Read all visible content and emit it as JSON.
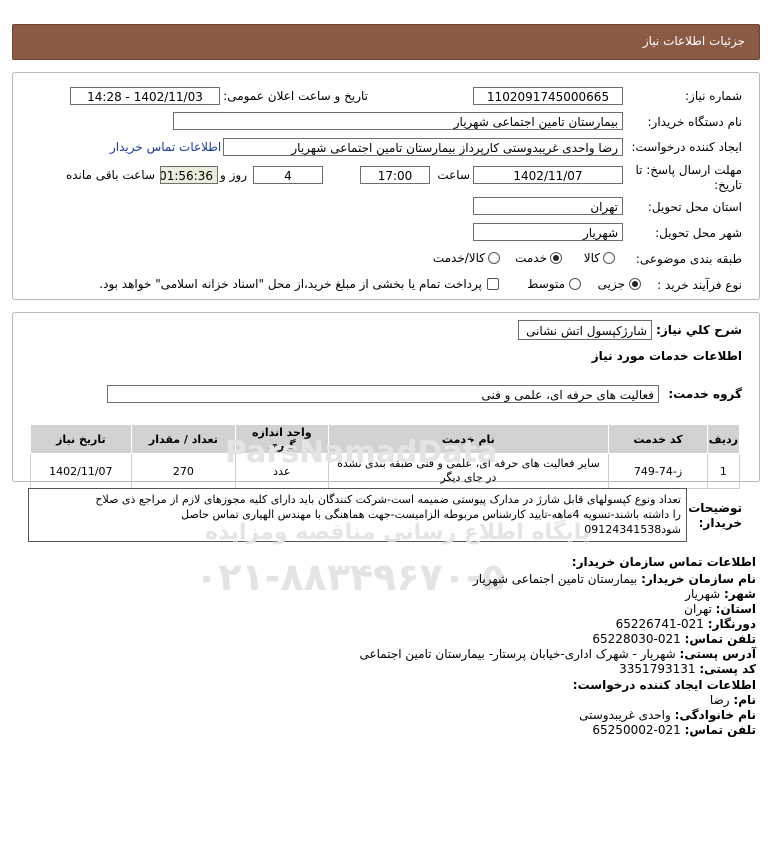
{
  "header": {
    "title": "جزئیات اطلاعات نیاز"
  },
  "need": {
    "number_label": "شماره نیاز:",
    "number": "1102091745000665",
    "announce_label": "تاریخ و ساعت اعلان عمومی:",
    "announce_value": "1402/11/03 - 14:28",
    "buyer_label": "نام دستگاه خریدار:",
    "buyer": "بیمارستان تامین اجتماعی شهریار",
    "creator_label": "ایجاد کننده درخواست:",
    "creator": "رضا واحدی غریبدوستی کارپرداز بیمارستان تامین اجتماعی شهریار",
    "contact_link": "اطلاعات تماس خریدار",
    "deadline_label_1": "مهلت ارسال پاسخ: تا",
    "deadline_label_2": "تاریخ:",
    "deadline_date": "1402/11/07",
    "time_label": "ساعت",
    "deadline_time": "17:00",
    "days": "4",
    "days_label": "روز و",
    "remaining": "01:56:36",
    "remaining_label": "ساعت باقی مانده",
    "province_label": "استان محل تحویل:",
    "province": "تهران",
    "city_label": "شهر محل تحویل:",
    "city": "شهریار",
    "category_label": "طبقه بندی موضوعی:",
    "category_options": [
      "کالا",
      "خدمت",
      "کالا/خدمت"
    ],
    "process_label": "نوع فرآیند خرید :",
    "process_options": [
      "جزیی",
      "متوسط"
    ],
    "payment_note": "پرداخت تمام یا بخشی از مبلغ خرید،از محل \"اسناد خزانه اسلامی\" خواهد بود."
  },
  "summary": {
    "label": "شرح کلي نياز:",
    "value": "شارژکپسول اتش نشانی",
    "section_title": "اطلاعات خدمات مورد نیاز",
    "group_label": "گروه خدمت:",
    "group_value": "فعالیت های حرفه ای، علمی و فنی"
  },
  "table": {
    "headers": [
      "ردیف",
      "کد خدمت",
      "نام خدمت",
      "واحد اندازه گیری",
      "تعداد / مقدار",
      "تاریخ نیاز"
    ],
    "rows": [
      {
        "row": "1",
        "code": "ز-74-749",
        "name_1": "سایر فعالیت های حرفه ای، علمی و فنی طبقه بندی نشده",
        "name_2": "در جای دیگر",
        "unit": "عدد",
        "qty": "270",
        "date": "1402/11/07"
      }
    ]
  },
  "description": {
    "label_1": "توضیحات",
    "label_2": "خریدار:",
    "line_1": "تعداد ونوع کپسولهای قابل شارژ در مدارک پیوستی ضمیمه است-شرکت کنندگان باید دارای کلیه مجوزهای لازم از مراجع ذی صلاح",
    "line_2": "را داشته باشند-تسویه 4ماهه-تایید کارشناس مربوطه الزامیست-جهت هماهنگی با مهندس الهیاری تماس حاصل",
    "line_3": "شود09124341538"
  },
  "contact": {
    "title": "اطلاعات تماس سازمان خریدار:",
    "org_label": "نام سازمان خریدار:",
    "org": "بیمارستان تامین اجتماعی شهریار",
    "city_label": "شهر:",
    "city": "شهریار",
    "province_label": "استان:",
    "province": "تهران",
    "fax_label": "دورنگار:",
    "fax": "021-65226741",
    "phone_label": "تلفن تماس:",
    "phone": "021-65228030",
    "address_label": "آدرس پستی:",
    "address": "شهریار - شهرک اداری-خیابان پرستار- بیمارستان تامین اجتماعی",
    "postal_label": "کد پستی:",
    "postal": "3351793131",
    "creator_title": "اطلاعات ایجاد کننده درخواست:",
    "name_label": "نام:",
    "name": "رضا",
    "family_label": "نام خانوادگی:",
    "family": "واحدی غریبدوستی",
    "creator_phone_label": "تلفن تماس:",
    "creator_phone": "021-65250002"
  },
  "watermark": {
    "number": "۰۲۱-۸۸۳۴۹۶۷۰-۵",
    "latin": "ParsNamadData",
    "text": "پایگاه اطلاع رسانی مناقصه ومزایده"
  }
}
